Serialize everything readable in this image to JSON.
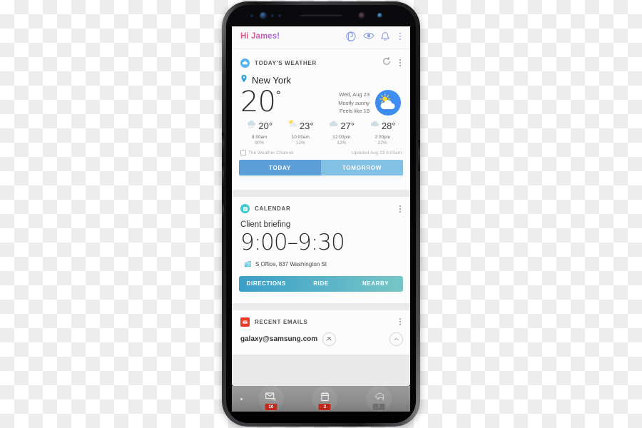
{
  "app": {
    "greeting": "Hi James!",
    "header_icons": [
      "bixby-icon",
      "eye-icon",
      "bell-icon",
      "overflow-menu-icon"
    ]
  },
  "weather_card": {
    "title": "TODAY'S WEATHER",
    "badge_icon": "cloud-icon",
    "refresh_icon": "refresh-icon",
    "overflow_icon": "overflow-menu-icon",
    "location_icon": "location-pin-icon",
    "location": "New York",
    "temperature": "20",
    "degree": "°",
    "date": "Wed, Aug 23",
    "condition": "Mostly sunny",
    "feels_like": "Feels like 18",
    "condition_icon": "sun-behind-cloud-icon",
    "hourly": [
      {
        "icon": "rain-cloud-icon",
        "temp": "20°",
        "time": "8:00am",
        "precip": "90%"
      },
      {
        "icon": "sun-cloud-icon",
        "temp": "23°",
        "time": "10:00am",
        "precip": "12%"
      },
      {
        "icon": "cloud-icon",
        "temp": "27°",
        "time": "12:00pm",
        "precip": "12%"
      },
      {
        "icon": "cloud-icon",
        "temp": "28°",
        "time": "2:00pm",
        "precip": "22%"
      }
    ],
    "source": "The Weather Channel",
    "updated": "Updated Aug 23  8:00am",
    "tabs": [
      {
        "label": "TODAY",
        "active": true
      },
      {
        "label": "TOMORROW",
        "active": false
      }
    ]
  },
  "calendar_card": {
    "title": "CALENDAR",
    "badge_icon": "calendar-icon",
    "overflow_icon": "overflow-menu-icon",
    "event": "Client briefing",
    "time": "9:00–9:30",
    "place_icon": "building-icon",
    "place": "S Office, 837 Washington St",
    "actions": [
      "DIRECTIONS",
      "RIDE",
      "NEARBY"
    ]
  },
  "emails_card": {
    "title": "RECENT EMAILS",
    "badge_icon": "envelope-icon",
    "overflow_icon": "overflow-menu-icon",
    "address": "galaxy@samsung.com",
    "expand_icon": "chevron-up-icon",
    "collapse_icon": "chevron-up-icon"
  },
  "dock": {
    "items": [
      {
        "icon": "mail-icon",
        "badge": "10"
      },
      {
        "icon": "calendar-icon",
        "badge": "2"
      },
      {
        "icon": "reply-icon",
        "badge": "7"
      }
    ]
  },
  "colors": {
    "accent_blue": "#5c9fd8",
    "accent_blue_light": "#83c0e4",
    "teal": "#3ec8cf",
    "weather_badge": "#53b4f0",
    "mail_badge": "#ec3b2b",
    "badge_red": "#c4281c",
    "greeting_from": "#e8507f",
    "greeting_to": "#9b6ad8"
  }
}
